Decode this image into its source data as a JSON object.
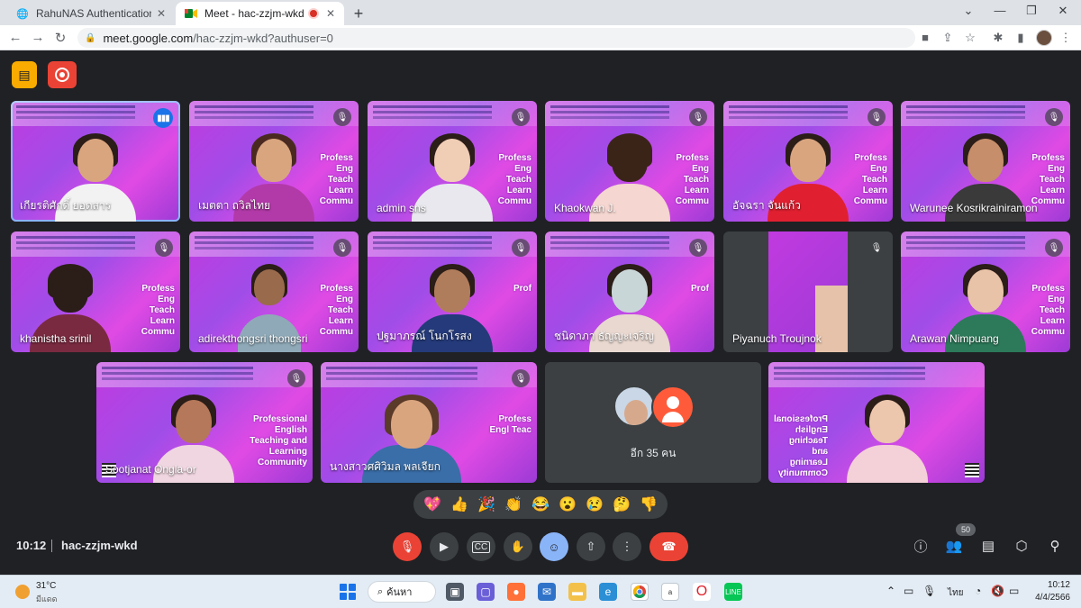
{
  "browser": {
    "tabs": [
      {
        "title": "RahuNAS Authentication",
        "icon": "globe-icon"
      },
      {
        "title": "Meet - hac-zzjm-wkd",
        "icon": "meet-icon",
        "recording": true
      }
    ],
    "url_host": "meet.google.com",
    "url_path": "/hac-zzjm-wkd?authuser=0"
  },
  "meet": {
    "tiles": [
      {
        "name": "เกียรติศักดิ์ ยอดสาร",
        "slogan": "",
        "status": "speaking"
      },
      {
        "name": "เมตตา ถวิลไทย",
        "slogan": "Profess Eng Teach Learn Commu",
        "status": "muted"
      },
      {
        "name": "admin sns",
        "slogan": "Profess Eng Teach Learn Commu",
        "status": "muted"
      },
      {
        "name": "Khaokwan J.",
        "slogan": "Profess Eng Teach Learn Commu",
        "status": "muted"
      },
      {
        "name": "อัจฉรา จันแก้ว",
        "slogan": "Profess Eng Teach Learn Commu",
        "status": "muted"
      },
      {
        "name": "Warunee Kosrikrainiramon",
        "slogan": "Profess Eng Teach Learn Commu",
        "status": "muted"
      },
      {
        "name": "khanistha srinil",
        "slogan": "Profess Eng Teach Learn Commu",
        "status": "muted"
      },
      {
        "name": "adirekthongsri thongsri",
        "slogan": "Profess Eng Teach Learn Commu",
        "status": "muted"
      },
      {
        "name": "ปฐมาภรณ์ โนกโรสง",
        "slogan": "Prof",
        "status": "muted"
      },
      {
        "name": "ชนิดาภา ธัญญะเจริญ",
        "slogan": "Prof",
        "status": "muted"
      },
      {
        "name": "Piyanuch Troujnok",
        "slogan": "",
        "status": "muted"
      },
      {
        "name": "Arawan Nimpuang",
        "slogan": "Profess Eng Teach Learn Commu",
        "status": "muted"
      },
      {
        "name": "Sootjanat Ongla-or",
        "slogan": "Professional English Teaching and Learning Community",
        "status": "muted"
      },
      {
        "name": "นางสาวศศิวิมล พลเจียก",
        "slogan": "Profess Engl Teac",
        "status": "muted"
      },
      {
        "name": "",
        "slogan": "Professional English Teaching and Learning Community",
        "status": "none"
      }
    ],
    "more_label": "อีก 35 คน",
    "reactions": [
      "💖",
      "👍",
      "🎉",
      "👏",
      "😂",
      "😮",
      "😢",
      "🤔",
      "👎"
    ],
    "time": "10:12",
    "code": "hac-zzjm-wkd",
    "people_count": "50"
  },
  "taskbar": {
    "temp": "31°C",
    "condition": "มีแดด",
    "search_label": "ค้นหา",
    "lang": "ไทย",
    "time": "10:12",
    "date": "4/4/2566"
  },
  "colors": {
    "accent": "#8ab4f8",
    "danger": "#ea4335",
    "bg": "#202124",
    "tile_purple": "#c13ae0"
  }
}
